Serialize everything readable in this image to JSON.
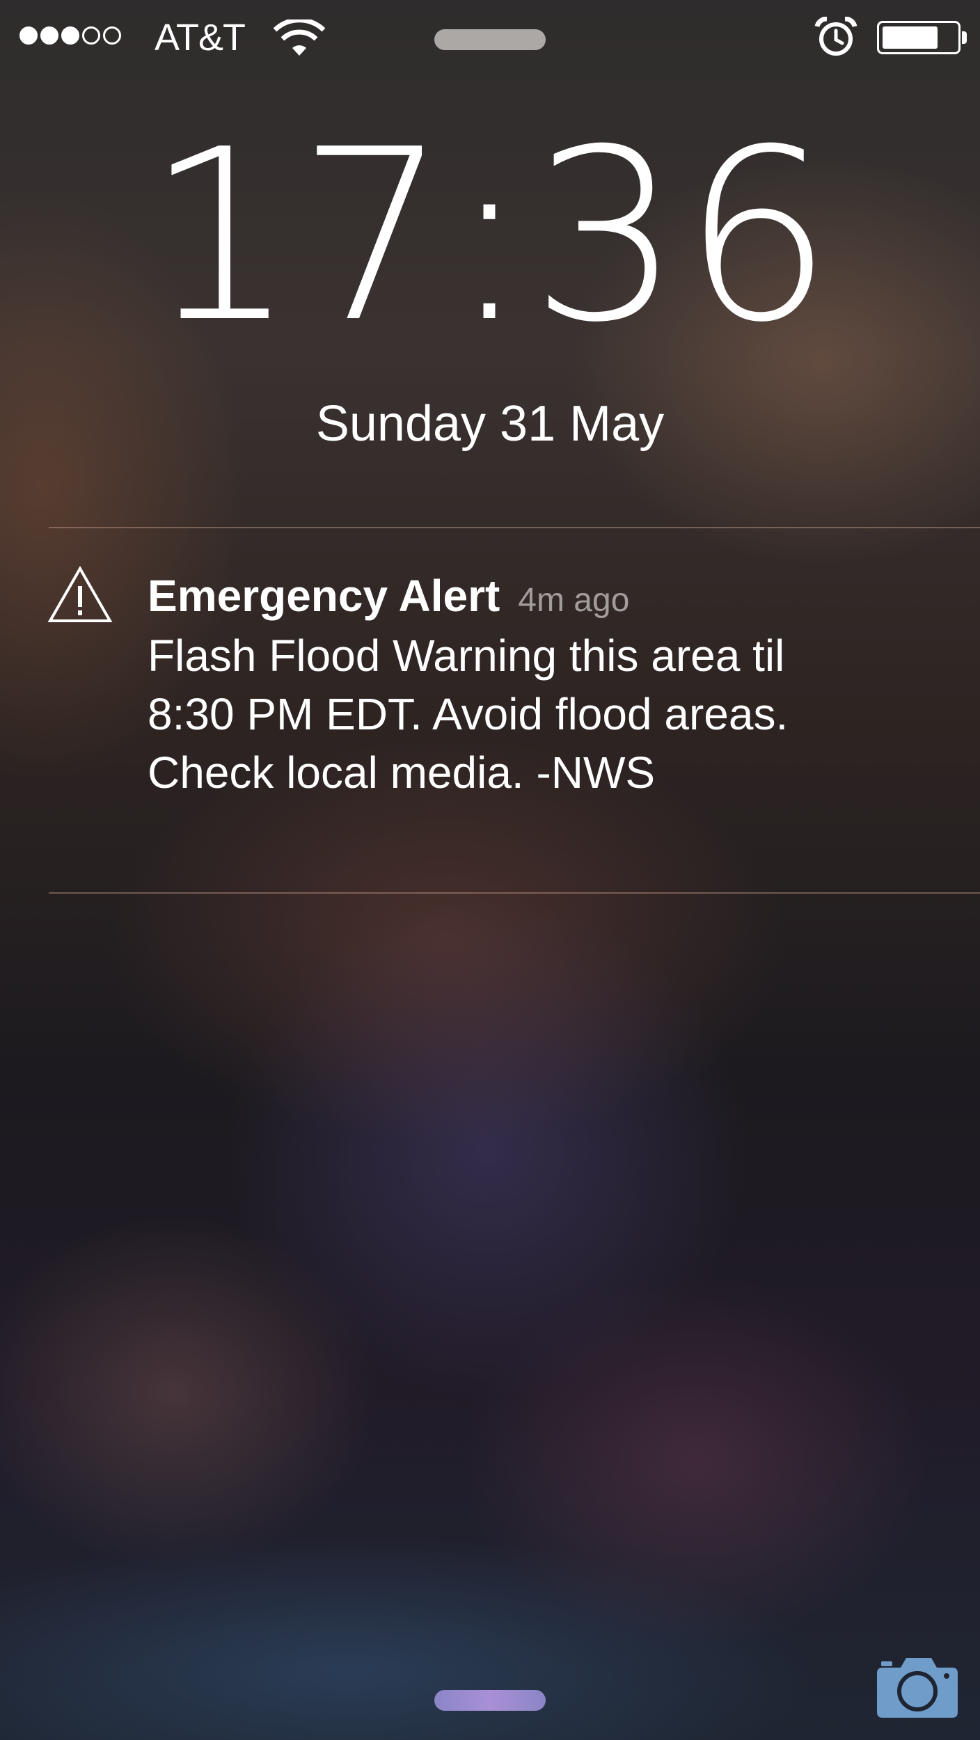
{
  "status_bar": {
    "signal_strength": 3,
    "signal_max": 5,
    "carrier": "AT&T",
    "wifi_icon": "wifi-icon",
    "alarm_icon": "alarm-clock-icon",
    "battery_level": 0.75
  },
  "lock_screen": {
    "time": "17:36",
    "date": "Sunday 31 May"
  },
  "notification": {
    "icon": "warning-triangle-icon",
    "title": "Emergency Alert",
    "time_ago": "4m ago",
    "body_lines": [
      "Flash Flood Warning this area til",
      "8:30 PM EDT. Avoid flood areas.",
      "Check local media. -NWS"
    ]
  },
  "bottom": {
    "camera_icon": "camera-icon"
  },
  "colors": {
    "camera_icon": "#6f9cc9",
    "grabber": "#a98fd6"
  }
}
